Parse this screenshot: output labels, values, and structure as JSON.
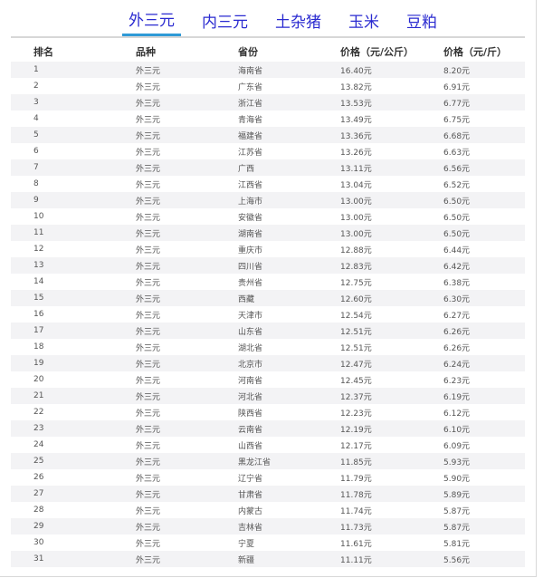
{
  "tabs": [
    {
      "label": "外三元",
      "active": true
    },
    {
      "label": "内三元",
      "active": false
    },
    {
      "label": "土杂猪",
      "active": false
    },
    {
      "label": "玉米",
      "active": false
    },
    {
      "label": "豆粕",
      "active": false
    }
  ],
  "table": {
    "headers": [
      "排名",
      "品种",
      "省份",
      "价格（元/公斤）",
      "价格（元/斤）"
    ],
    "rows": [
      [
        "1",
        "外三元",
        "海南省",
        "16.40元",
        "8.20元"
      ],
      [
        "2",
        "外三元",
        "广东省",
        "13.82元",
        "6.91元"
      ],
      [
        "3",
        "外三元",
        "浙江省",
        "13.53元",
        "6.77元"
      ],
      [
        "4",
        "外三元",
        "青海省",
        "13.49元",
        "6.75元"
      ],
      [
        "5",
        "外三元",
        "福建省",
        "13.36元",
        "6.68元"
      ],
      [
        "6",
        "外三元",
        "江苏省",
        "13.26元",
        "6.63元"
      ],
      [
        "7",
        "外三元",
        "广西",
        "13.11元",
        "6.56元"
      ],
      [
        "8",
        "外三元",
        "江西省",
        "13.04元",
        "6.52元"
      ],
      [
        "9",
        "外三元",
        "上海市",
        "13.00元",
        "6.50元"
      ],
      [
        "10",
        "外三元",
        "安徽省",
        "13.00元",
        "6.50元"
      ],
      [
        "11",
        "外三元",
        "湖南省",
        "13.00元",
        "6.50元"
      ],
      [
        "12",
        "外三元",
        "重庆市",
        "12.88元",
        "6.44元"
      ],
      [
        "13",
        "外三元",
        "四川省",
        "12.83元",
        "6.42元"
      ],
      [
        "14",
        "外三元",
        "贵州省",
        "12.75元",
        "6.38元"
      ],
      [
        "15",
        "外三元",
        "西藏",
        "12.60元",
        "6.30元"
      ],
      [
        "16",
        "外三元",
        "天津市",
        "12.54元",
        "6.27元"
      ],
      [
        "17",
        "外三元",
        "山东省",
        "12.51元",
        "6.26元"
      ],
      [
        "18",
        "外三元",
        "湖北省",
        "12.51元",
        "6.26元"
      ],
      [
        "19",
        "外三元",
        "北京市",
        "12.47元",
        "6.24元"
      ],
      [
        "20",
        "外三元",
        "河南省",
        "12.45元",
        "6.23元"
      ],
      [
        "21",
        "外三元",
        "河北省",
        "12.37元",
        "6.19元"
      ],
      [
        "22",
        "外三元",
        "陕西省",
        "12.23元",
        "6.12元"
      ],
      [
        "23",
        "外三元",
        "云南省",
        "12.19元",
        "6.10元"
      ],
      [
        "24",
        "外三元",
        "山西省",
        "12.17元",
        "6.09元"
      ],
      [
        "25",
        "外三元",
        "黑龙江省",
        "11.85元",
        "5.93元"
      ],
      [
        "26",
        "外三元",
        "辽宁省",
        "11.79元",
        "5.90元"
      ],
      [
        "27",
        "外三元",
        "甘肃省",
        "11.78元",
        "5.89元"
      ],
      [
        "28",
        "外三元",
        "内蒙古",
        "11.74元",
        "5.87元"
      ],
      [
        "29",
        "外三元",
        "吉林省",
        "11.73元",
        "5.87元"
      ],
      [
        "30",
        "外三元",
        "宁夏",
        "11.61元",
        "5.81元"
      ],
      [
        "31",
        "外三元",
        "新疆",
        "11.11元",
        "5.56元"
      ]
    ]
  },
  "colors": {
    "tab_text": "#2a2ad0",
    "tab_underline": "#2f9ad6",
    "row_stripe": "#f3f3f5"
  }
}
